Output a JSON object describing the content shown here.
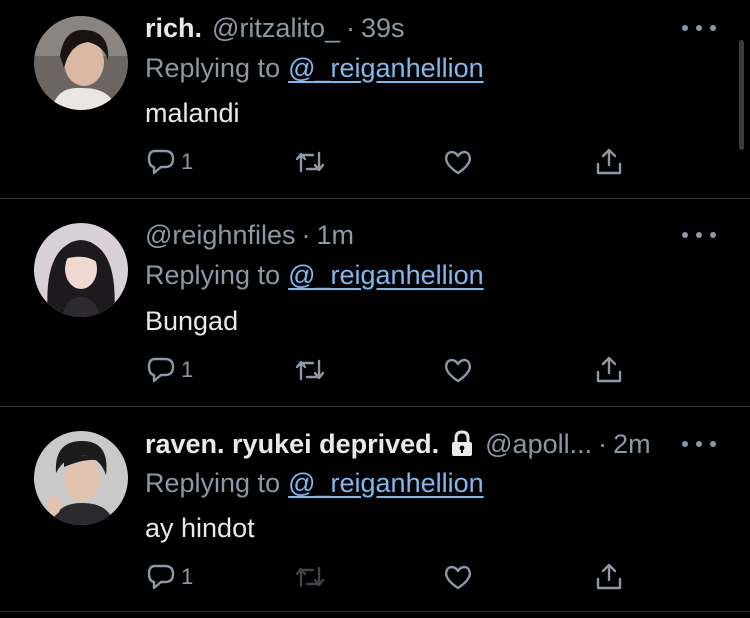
{
  "tweets": [
    {
      "name": "rich.",
      "handle": "@ritzalito_",
      "time": "39s",
      "reply_prefix": "Replying to",
      "reply_to": "@_reiganhellion",
      "text": "malandi",
      "reply_count": "1",
      "icons": [
        "reply-icon",
        "retweet-icon",
        "like-icon",
        "share-icon"
      ]
    },
    {
      "name": "",
      "handle": "@reighnfiles",
      "time": "1m",
      "reply_prefix": "Replying to",
      "reply_to": "@_reiganhellion",
      "text": "Bungad",
      "reply_count": "1",
      "icons": [
        "reply-icon",
        "retweet-icon",
        "like-icon",
        "share-icon"
      ]
    },
    {
      "name": "raven. ryukei deprived.",
      "protected_icon": "lock-icon",
      "handle": "@apoll...",
      "time": "2m",
      "reply_prefix": "Replying to",
      "reply_to": "@_reiganhellion",
      "text": "ay hindot",
      "reply_count": "1",
      "icons": [
        "reply-icon",
        "retweet-icon",
        "like-icon",
        "share-icon"
      ]
    }
  ],
  "colors": {
    "background": "#000000",
    "text": "#e7e9ea",
    "secondary": "#8b98a5",
    "link": "#7fb9ee",
    "divider": "#2f3336"
  }
}
